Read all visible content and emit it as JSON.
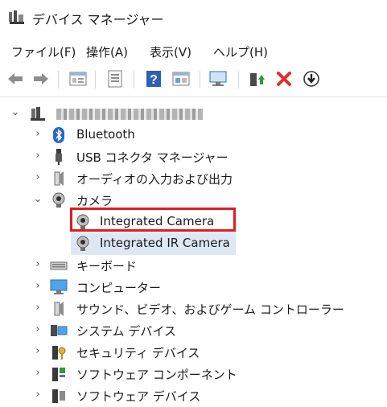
{
  "window": {
    "title": "デバイス マネージャー"
  },
  "menu": [
    "ファイル(F)",
    "操作(A)",
    "表示(V)",
    "ヘルプ(H)"
  ],
  "toolbar": {
    "buttons": [
      "back-arrow-icon",
      "forward-arrow-icon",
      "properties-icon",
      "list-view-icon",
      "help-icon",
      "view-resources-icon",
      "scan-hardware-icon",
      "update-driver-icon",
      "uninstall-icon",
      "disable-device-icon"
    ],
    "colors": {
      "help": "#2d5fb8",
      "uninstall": "#e0302a",
      "update": "#2f9b3a"
    }
  },
  "tree": {
    "computer_name": "",
    "categories": [
      {
        "label": "Bluetooth",
        "icon": "bluetooth-icon",
        "expanded": false
      },
      {
        "label": "USB コネクタ マネージャー",
        "icon": "usb-icon",
        "expanded": false
      },
      {
        "label": "オーディオの入力および出力",
        "icon": "speaker-icon",
        "expanded": false
      },
      {
        "label": "カメラ",
        "icon": "camera-icon",
        "expanded": true,
        "children": [
          "Integrated Camera",
          "Integrated IR Camera"
        ]
      },
      {
        "label": "キーボード",
        "icon": "keyboard-icon",
        "expanded": false
      },
      {
        "label": "コンピューター",
        "icon": "monitor-icon",
        "expanded": false
      },
      {
        "label": "サウンド、ビデオ、およびゲーム コントローラー",
        "icon": "speaker-icon",
        "expanded": false
      },
      {
        "label": "システム デバイス",
        "icon": "system-device-icon",
        "expanded": false
      },
      {
        "label": "セキュリティ デバイス",
        "icon": "security-key-icon",
        "expanded": false
      },
      {
        "label": "ソフトウェア コンポーネント",
        "icon": "software-component-icon",
        "expanded": false
      },
      {
        "label": "ソフトウェア デバイス",
        "icon": "software-device-icon",
        "expanded": false
      }
    ],
    "selected_child": "Integrated IR Camera",
    "highlight": {
      "target": "Integrated Camera",
      "color": "#e11b22"
    }
  }
}
